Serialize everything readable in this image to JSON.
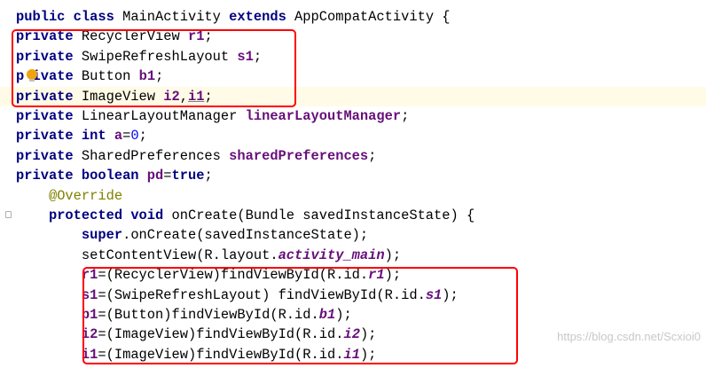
{
  "lines": {
    "l1": {
      "kw1": "public class ",
      "name": "MainActivity ",
      "kw2": "extends ",
      "rest": "AppCompatActivity {"
    },
    "l2": {
      "kw": "private ",
      "type": "RecyclerView ",
      "field": "r1",
      "end": ";"
    },
    "l3": {
      "kw": "private ",
      "type": "SwipeRefreshLayout ",
      "field": "s1",
      "end": ";"
    },
    "l4": {
      "kw_a": "p",
      "kw_b": "ivate ",
      "type": "Button ",
      "field": "b1",
      "end": ";"
    },
    "l5": {
      "kw": "private ",
      "type": "ImageView ",
      "field1": "i2",
      "comma": ",",
      "field2": "i1",
      "end": ";"
    },
    "l6": {
      "kw": "private ",
      "type": "LinearLayoutManager ",
      "field": "linearLayoutManager",
      "end": ";"
    },
    "l7": {
      "kw1": "private ",
      "kw2": "int ",
      "field": "a",
      "eq": "=",
      "num": "0",
      "end": ";"
    },
    "l8": {
      "kw": "private ",
      "type": "SharedPreferences ",
      "field": "sharedPreferences",
      "end": ";"
    },
    "l9": {
      "kw1": "private ",
      "kw2": "boolean ",
      "field": "pd",
      "eq": "=",
      "kw3": "true",
      "end": ";"
    },
    "l10": {
      "indent": "    ",
      "annotation": "@Override"
    },
    "l11": {
      "indent": "    ",
      "kw1": "protected ",
      "kw2": "void ",
      "rest": "onCreate(Bundle savedInstanceState) {"
    },
    "l12": {
      "indent": "        ",
      "kw": "super",
      "rest": ".onCreate(savedInstanceState);"
    },
    "l13": {
      "indent": "        ",
      "pre": "setContentView(R.layout.",
      "ref": "activity_main",
      "end": ");"
    },
    "l14": {
      "indent": "        ",
      "field": "r1",
      "mid": "=(RecyclerView)findViewById(R.id.",
      "ref": "r1",
      "end": ");"
    },
    "l15": {
      "indent": "        ",
      "field": "s1",
      "mid": "=(SwipeRefreshLayout) findViewById(R.id.",
      "ref": "s1",
      "end": ");"
    },
    "l16": {
      "indent": "        ",
      "field": "b1",
      "mid": "=(Button)findViewById(R.id.",
      "ref": "b1",
      "end": ");"
    },
    "l17": {
      "indent": "        ",
      "field": "i2",
      "mid": "=(ImageView)findViewById(R.id.",
      "ref": "i2",
      "end": ");"
    },
    "l18": {
      "indent": "        ",
      "field": "i1",
      "mid": "=(ImageView)findViewById(R.id.",
      "ref": "i1",
      "end": ");"
    }
  },
  "watermark": "https://blog.csdn.net/Scxioi0",
  "colors": {
    "keyword": "#000080",
    "field": "#660e7a",
    "number": "#0000ff",
    "annotation": "#808000",
    "highlight_box": "#ff0000",
    "caret_line": "#fffbe6"
  },
  "icons": {
    "intention": "lightbulb-icon",
    "fold": "fold-marker-icon"
  }
}
